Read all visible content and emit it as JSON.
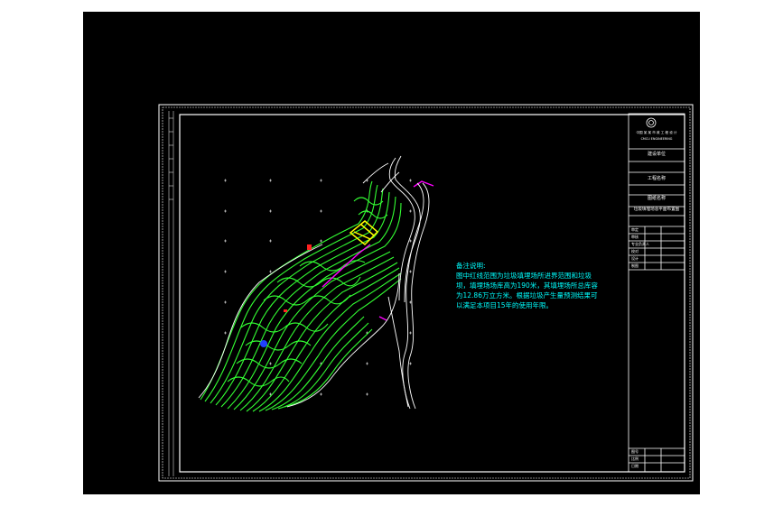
{
  "drawing": {
    "background": "#000000",
    "frame_color": "#ffffff",
    "terrain_color": "#33ff33",
    "road_color": "#ffffff",
    "highlight_color": "#ffff00",
    "magenta_color": "#ff00ff",
    "note_color": "#00ffff"
  },
  "notes": {
    "heading": "备注说明:",
    "line1": "图中红线范围为垃圾填埋场所进界范围和垃圾",
    "line2": "坝，填埋场场库高为190米，其填埋场所总库容",
    "line3": "为12.86万立方米。根据垃圾产生量预测结果可",
    "line4": "以满足本项目15年的使用年限。"
  },
  "title_block": {
    "company": "中国 某 某 市 政 工 程 设 计",
    "company_en": "CMCU ENGINEERING",
    "row1": "建设单位",
    "row2": "工程名称",
    "row3": "图纸名称",
    "drawing_name": "垃圾填埋场总平面布置图",
    "rows_small": [
      "审定",
      "审核",
      "专业负责人",
      "校对",
      "设计",
      "制图"
    ],
    "bottom_rows": [
      "图号",
      "比例",
      "日期"
    ]
  }
}
